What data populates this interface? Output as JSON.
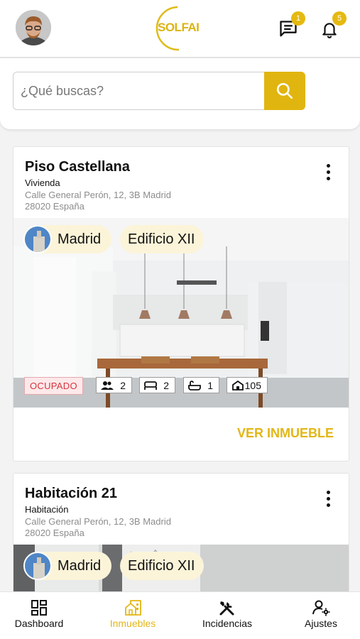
{
  "app": {
    "logo_text": "SOLFAI",
    "brand_color": "#e1b50f",
    "notifications": {
      "messages_badge": "1",
      "alerts_badge": "5"
    }
  },
  "search": {
    "placeholder": "¿Qué buscas?"
  },
  "listings": [
    {
      "title": "Piso Castellana",
      "type": "Vivienda",
      "address_line1": "Calle General Perón, 12, 3B Madrid",
      "address_line2": "28020 España",
      "chip_city": "Madrid",
      "chip_building": "Edificio XII",
      "status": "OCUPADO",
      "stats": {
        "people": "2",
        "beds": "2",
        "baths": "1",
        "area": "105"
      },
      "cta": "VER INMUEBLE"
    },
    {
      "title": "Habitación 21",
      "type": "Habitación",
      "address_line1": "Calle General Perón, 12, 3B Madrid",
      "address_line2": "28020 España",
      "chip_city": "Madrid",
      "chip_building": "Edificio XII"
    }
  ],
  "nav": {
    "dashboard": "Dashboard",
    "properties": "Inmuebles",
    "incidents": "Incidencias",
    "settings": "Ajustes",
    "active": "properties"
  }
}
